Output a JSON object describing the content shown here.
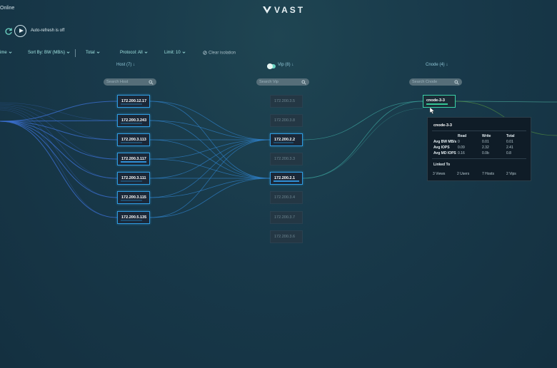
{
  "top": {
    "status": "Online",
    "logo": "VAST"
  },
  "controls": {
    "auto_refresh": "Auto-refresh is off"
  },
  "filters": {
    "time": "ime",
    "sort": "Sort By: BW (MB/s)",
    "total": "Total",
    "protocol": "Protocol: All",
    "limit": "Limit: 10",
    "clear": "Clear isolation"
  },
  "columns": {
    "host": {
      "header": "Host (7)",
      "search_placeholder": "Search Host"
    },
    "vip": {
      "header": "Vip (8)",
      "search_placeholder": "Search Vip"
    },
    "cnode": {
      "header": "Cnode (4)",
      "search_placeholder": "Search Cnode"
    }
  },
  "hosts": [
    "172.200.12.17",
    "172.200.3.243",
    "172.200.3.113",
    "172.200.3.117",
    "172.200.3.111",
    "172.200.3.115",
    "172.200.5.135"
  ],
  "vips": [
    {
      "label": "172.200.3.5",
      "active": false
    },
    {
      "label": "172.200.3.8",
      "active": false
    },
    {
      "label": "172.200.2.2",
      "active": true
    },
    {
      "label": "172.200.3.3",
      "active": false
    },
    {
      "label": "172.200.2.1",
      "active": true
    },
    {
      "label": "172.200.3.4",
      "active": false
    },
    {
      "label": "172.200.3.7",
      "active": false
    },
    {
      "label": "172.200.3.6",
      "active": false
    }
  ],
  "cnode": {
    "label": "cnode-3-3"
  },
  "tooltip": {
    "title": "cnode-3-3",
    "headers": {
      "read": "Read",
      "write": "Write",
      "total": "Total"
    },
    "rows": [
      {
        "label": "Avg BW MB/s",
        "read": "0",
        "write": "0.01",
        "total": "0.01"
      },
      {
        "label": "Avg IOPS",
        "read": "0.09",
        "write": "2.32",
        "total": "2.41"
      },
      {
        "label": "Avg MD IOPS",
        "read": "0.16",
        "write": "0.0b",
        "total": "0.8"
      }
    ],
    "linked_title": "Linked To",
    "linked": [
      "3  Views",
      "2  Users",
      "7  Hosts",
      "2  Vips"
    ]
  },
  "colors": {
    "accent": "#6dd5c4",
    "active_border": "#2f9be0",
    "link_blue": "#2f80c8",
    "link_green": "#4aa89a"
  }
}
